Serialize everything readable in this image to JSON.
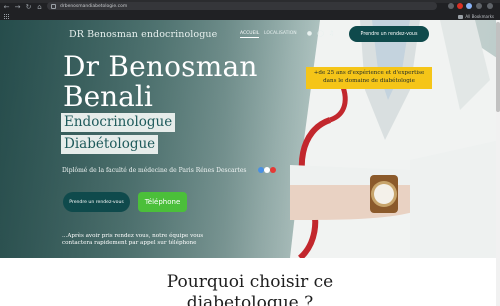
{
  "browser": {
    "url": "drbenosmandiabetologie.com",
    "all_bookmarks": "All Bookmarks",
    "back_icon": "arrow-left-icon",
    "forward_icon": "arrow-right-icon",
    "reload_icon": "reload-icon"
  },
  "header": {
    "site_title": "DR Benosman endocrinologue",
    "nav": [
      "ACCUEIL",
      "LOCALISATION"
    ],
    "social_icons": [
      "facebook-icon",
      "instagram-icon",
      "tiktok-icon"
    ],
    "cta": "Prendre un rendez-vous"
  },
  "hero": {
    "name_line1": "Dr Benosman",
    "name_line2": "Benali",
    "specialty_line1": "Endocrinologue",
    "specialty_line2": "Diabétologue",
    "badge_line1": "+de 25 ans d'expérience et d'expertise",
    "badge_line2": "dans le domaine de diabétologie",
    "diploma": "Diplômé de la faculté de médecine de Paris Rénes Descartes",
    "btn_rdv": "Prendre un rendez-vous",
    "btn_tel": "Téléphone",
    "note_line1": "...Après avoir pris rendez vous, notre équipe vous",
    "note_line2": "contactera rapidement par appel sur téléphone"
  },
  "section": {
    "title_line1": "Pourquoi choisir ce",
    "title_line2": "diabetologue ?"
  },
  "colors": {
    "teal_dark": "#0f4a4c",
    "green": "#4bbf3a",
    "yellow": "#f5c518"
  }
}
